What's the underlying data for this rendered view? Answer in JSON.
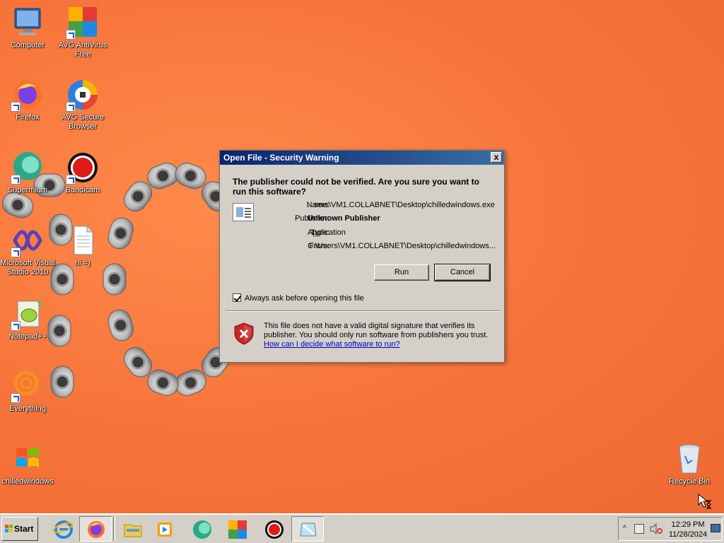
{
  "desktop": {
    "icons": [
      {
        "label": "Computer",
        "icon": "computer-icon"
      },
      {
        "label": "AVG AntiVirus Free",
        "icon": "avg-antivirus-icon"
      },
      {
        "label": "Firefox",
        "icon": "firefox-icon"
      },
      {
        "label": "AVG Secure Browser",
        "icon": "avg-browser-icon"
      },
      {
        "label": "Supermium",
        "icon": "supermium-icon"
      },
      {
        "label": "Bandicam",
        "icon": "bandicam-icon"
      },
      {
        "label": "Microsoft Visual Studio 2010",
        "icon": "visual-studio-icon"
      },
      {
        "label": "hi =)",
        "icon": "text-file-icon"
      },
      {
        "label": "Notepad++",
        "icon": "notepadpp-icon"
      },
      {
        "label": "Everything",
        "icon": "everything-icon"
      },
      {
        "label": "chilledwindows",
        "icon": "windows-flag-icon"
      },
      {
        "label": "Recycle Bin",
        "icon": "recycle-bin-icon"
      }
    ]
  },
  "dialog": {
    "title": "Open File - Security Warning",
    "close": "x",
    "heading": "The publisher could not be verified.  Are you sure you want to run this software?",
    "fields": [
      {
        "key": "Name:",
        "value": "...sers\\VM1.COLLABNET\\Desktop\\chilledwindows.exe",
        "bold": false
      },
      {
        "key": "Publisher:",
        "value": "Unknown Publisher",
        "bold": true
      },
      {
        "key": "Type:",
        "value": "Application",
        "bold": false
      },
      {
        "key": "From:",
        "value": "C:\\Users\\VM1.COLLABNET\\Desktop\\chilledwindows...",
        "bold": false
      }
    ],
    "run_label": "Run",
    "cancel_label": "Cancel",
    "always_ask_label": "Always ask before opening this file",
    "always_ask_checked": true,
    "warning_text": "This file does not have a valid digital signature that verifies its publisher.  You should only run software from publishers you trust.",
    "help_link": "How can I decide what software to run?"
  },
  "taskbar": {
    "start_label": "Start",
    "items": [
      {
        "icon": "internet-explorer-icon",
        "pressed": false
      },
      {
        "icon": "firefox-icon",
        "pressed": true
      },
      {
        "icon": "file-explorer-icon",
        "pressed": false
      },
      {
        "icon": "media-player-icon",
        "pressed": false
      },
      {
        "icon": "supermium-icon",
        "pressed": false
      },
      {
        "icon": "avg-antivirus-icon",
        "pressed": false
      },
      {
        "icon": "bandicam-icon",
        "pressed": false
      },
      {
        "icon": "generic-app-icon",
        "pressed": true
      }
    ],
    "clock_time": "12:29 PM",
    "clock_date": "11/28/2024",
    "tray_chevron": "^"
  },
  "colors": {
    "wallpaper": "#f6733a",
    "title_bar": "#0a246a",
    "dialog_face": "#d4d0c8",
    "link": "#0000cc"
  }
}
